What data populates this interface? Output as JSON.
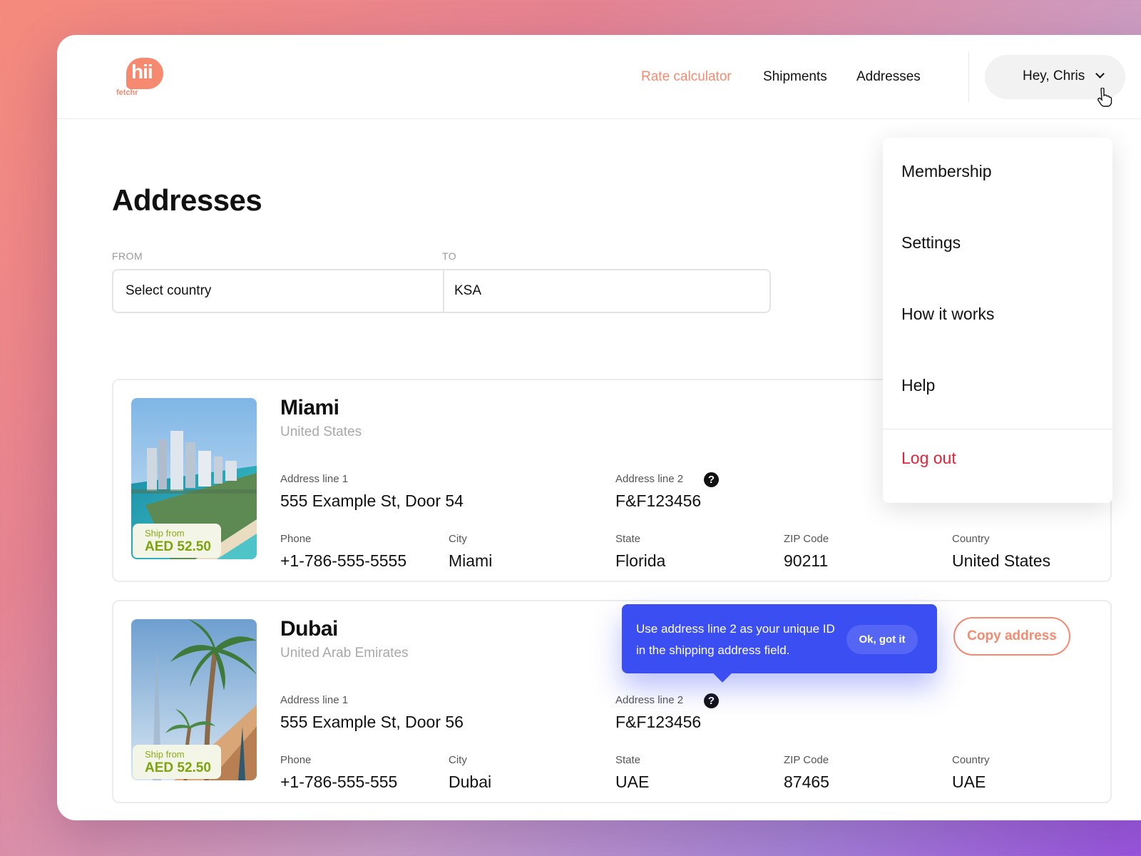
{
  "colors": {
    "accent": "#f58a70",
    "tooltip": "#3b4ef2",
    "logout": "#e0253a",
    "badge_text": "#7da30f"
  },
  "brand": {
    "logo_text": "hii",
    "logo_sub": "fetchr"
  },
  "nav": {
    "items": [
      {
        "label": "Rate calculator",
        "active": true
      },
      {
        "label": "Shipments",
        "active": false
      },
      {
        "label": "Addresses",
        "active": false
      }
    ],
    "user_greeting": "Hey, Chris"
  },
  "page": {
    "title": "Addresses"
  },
  "route": {
    "from_label": "FROM",
    "to_label": "TO",
    "from_value": "Select country",
    "to_value": "KSA"
  },
  "addresses": [
    {
      "city": "Miami",
      "country_name": "United States",
      "ship_from_label": "Ship from",
      "ship_from_price": "AED 52.50",
      "address1_label": "Address line 1",
      "address1": "555 Example St, Door 54",
      "address2_label": "Address line 2",
      "address2": "F&F123456",
      "phone_label": "Phone",
      "phone": "+1-786-555-5555",
      "city_label": "City",
      "city_value": "Miami",
      "state_label": "State",
      "state": "Florida",
      "zip_label": "ZIP Code",
      "zip": "90211",
      "country_label": "Country",
      "country": "United States"
    },
    {
      "city": "Dubai",
      "country_name": "United Arab Emirates",
      "ship_from_label": "Ship from",
      "ship_from_price": "AED 52.50",
      "address1_label": "Address line 1",
      "address1": "555 Example St, Door 56",
      "address2_label": "Address line 2",
      "address2": "F&F123456",
      "phone_label": "Phone",
      "phone": "+1-786-555-555",
      "city_label": "City",
      "city_value": "Dubai",
      "state_label": "State",
      "state": "UAE",
      "zip_label": "ZIP Code",
      "zip": "87465",
      "country_label": "Country",
      "country": "UAE",
      "copy_button": "Copy address"
    }
  ],
  "tooltip": {
    "text": "Use address line 2 as your unique ID in the shipping address field.",
    "button": "Ok, got it"
  },
  "user_menu": {
    "items": [
      "Membership",
      "Settings",
      "How it works",
      "Help"
    ],
    "logout": "Log out"
  },
  "icons": {
    "help": "question-circle-icon",
    "chevron": "chevron-down-icon",
    "cursor": "hand-pointer-icon"
  }
}
